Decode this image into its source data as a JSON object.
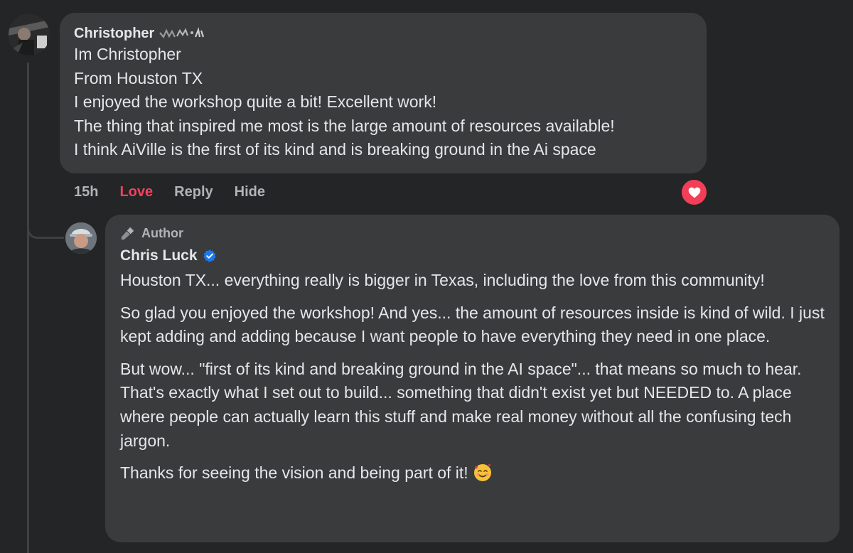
{
  "thread": {
    "top_comment": {
      "author": "Christopher",
      "lines": [
        "Im Christopher",
        "From Houston TX",
        "I enjoyed the workshop quite a bit! Excellent work!",
        "The thing that inspired me most is the large amount of resources available!",
        "I think AiVille is the first of its kind and is breaking ground in the Ai space"
      ],
      "actions": {
        "time": "15h",
        "love": "Love",
        "reply": "Reply",
        "hide": "Hide"
      },
      "reaction_icon": "heart-icon",
      "love_color": "#f3425f"
    },
    "reply": {
      "badge_icon": "microphone-icon",
      "badge_label": "Author",
      "author": "Chris Luck",
      "verified_icon": "verified-badge-icon",
      "paragraphs": [
        "Houston TX... everything really is bigger in Texas, including the love from this community!",
        "So glad you enjoyed the workshop! And yes... the amount of resources inside is kind of wild. I just kept adding and adding because I want people to have everything they need in one place.",
        "But wow... \"first of its kind and breaking ground in the AI space\"... that means so much to hear. That's exactly what I set out to build... something that didn't exist yet but NEEDED to. A place where people can actually learn this stuff and make real money without all the confusing tech jargon.",
        "Thanks for seeing the vision and being part of it!"
      ],
      "emoji_icon": "smiling-face-with-hearts-icon",
      "verified_color": "#1877f2"
    }
  }
}
